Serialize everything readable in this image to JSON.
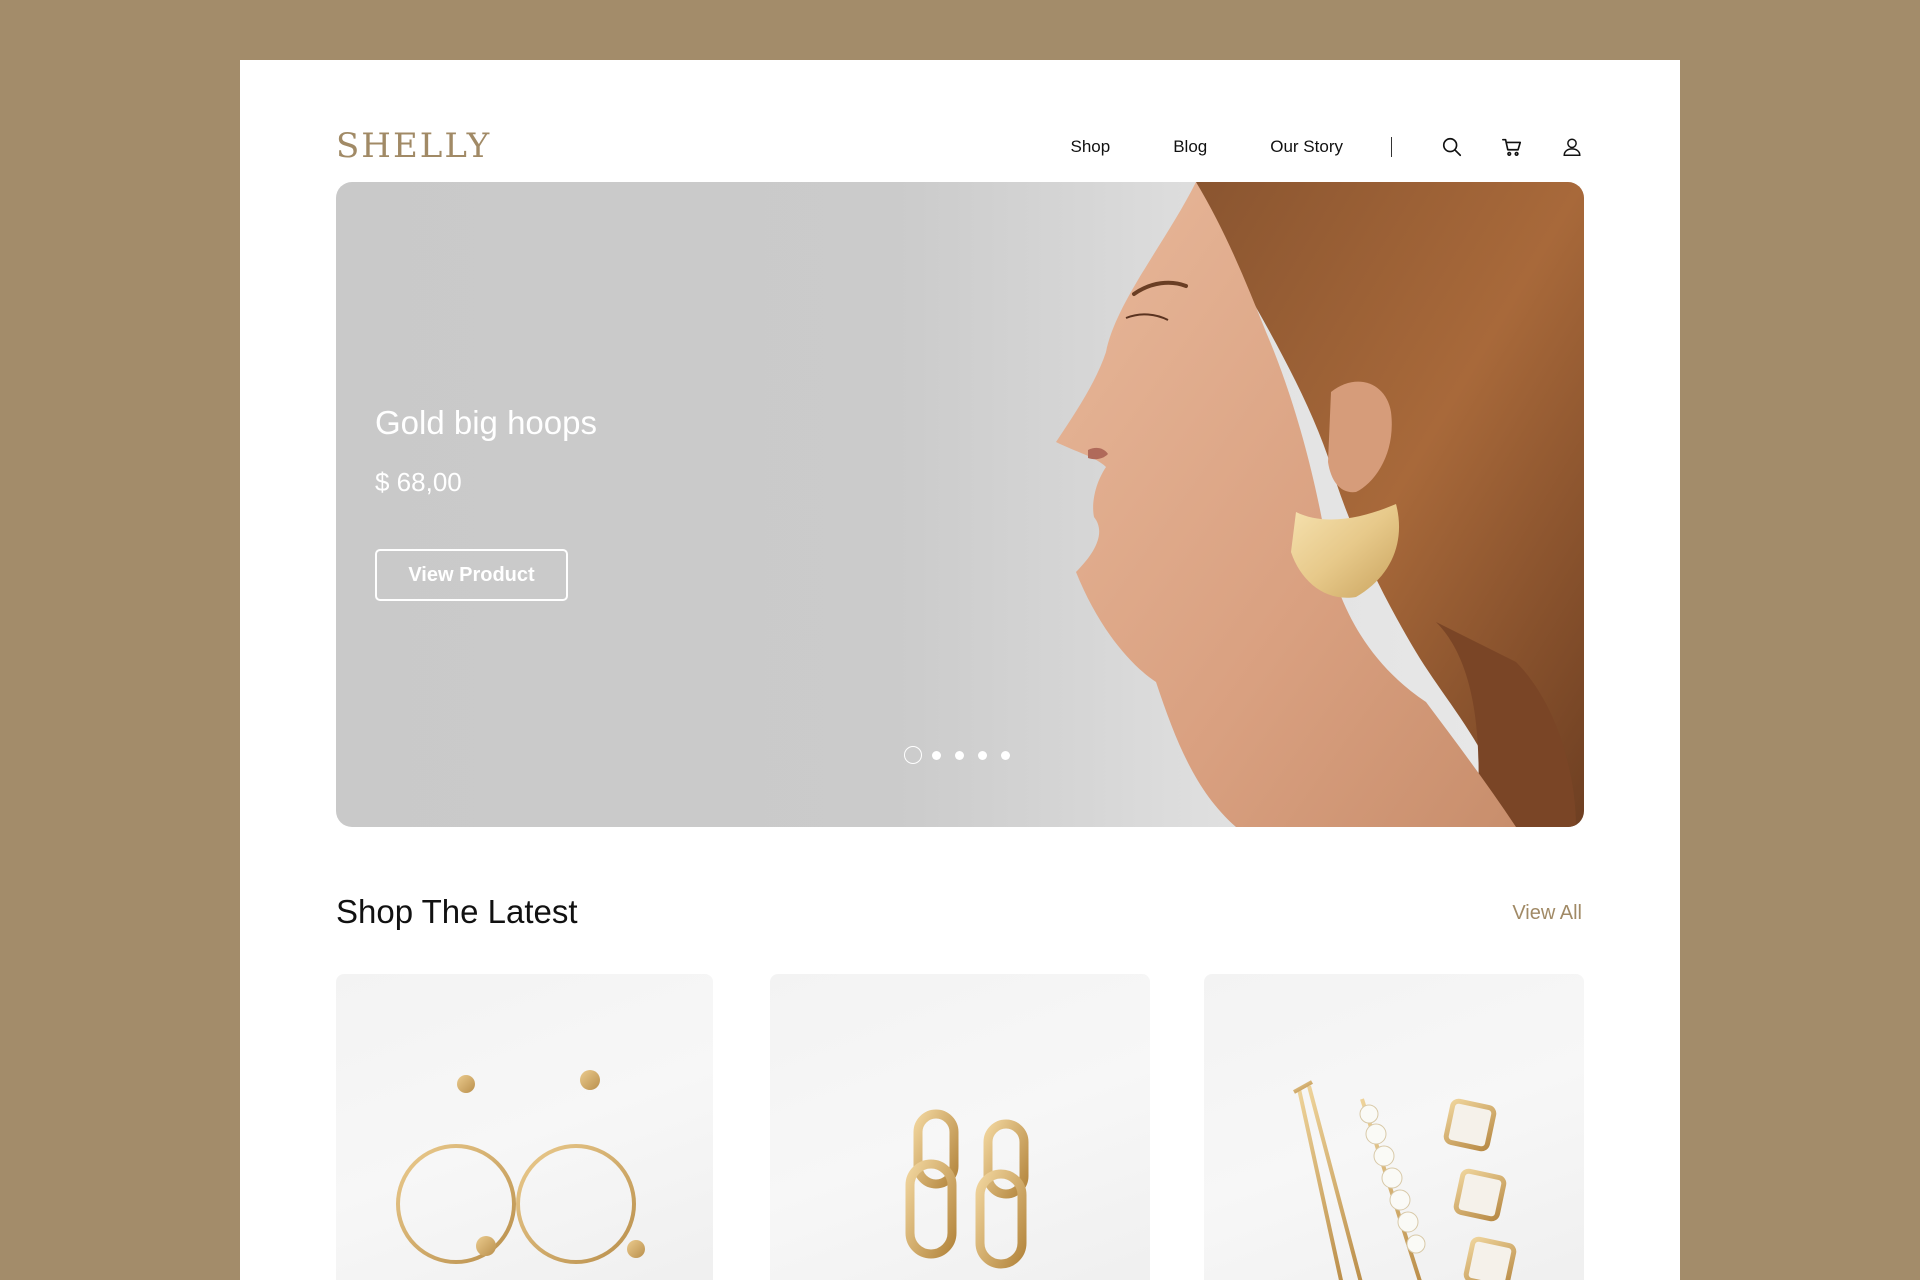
{
  "brand": {
    "logo": "SHELLY"
  },
  "nav": {
    "links": [
      "Shop",
      "Blog",
      "Our Story"
    ],
    "icons": [
      "search-icon",
      "cart-icon",
      "user-icon"
    ]
  },
  "hero": {
    "title": "Gold big hoops",
    "price": "$ 68,00",
    "button_label": "View Product",
    "carousel": {
      "total_slides": 5,
      "active_slide": 1
    }
  },
  "section": {
    "title": "Shop The Latest",
    "view_all": "View All",
    "products": [
      {
        "image": "gold-circle-earrings"
      },
      {
        "image": "gold-chain-link-earrings"
      },
      {
        "image": "gold-pearl-hair-clips"
      }
    ]
  },
  "colors": {
    "background": "#A38C6A",
    "accent": "#A18A66",
    "hero_bg": "#C9C9C9",
    "text": "#111111"
  }
}
